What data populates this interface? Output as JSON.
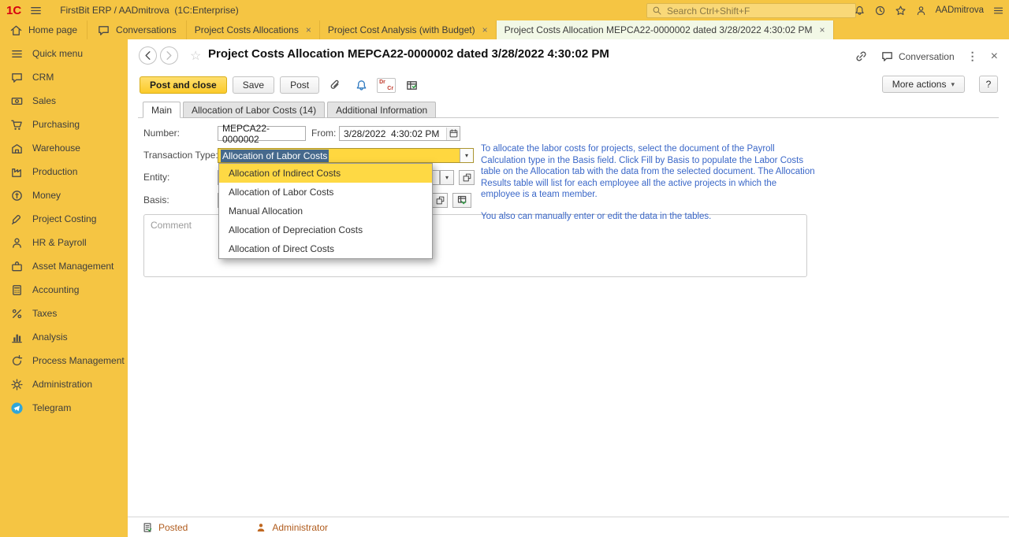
{
  "topbar": {
    "logo": "1С",
    "app_title": "FirstBit ERP / AADmitrova  (1C:Enterprise)",
    "search_placeholder": "Search Ctrl+Shift+F",
    "user": "AADmitrova"
  },
  "nav": {
    "home": "Home page",
    "conversations": "Conversations",
    "tabs": [
      {
        "label": "Project Costs Allocations"
      },
      {
        "label": "Project Cost Analysis (with Budget)"
      },
      {
        "label": "Project Costs Allocation MEPCA22-0000002 dated 3/28/2022 4:30:02 PM"
      }
    ]
  },
  "sidebar": {
    "items": [
      {
        "label": "Quick menu",
        "icon": "menu-icon"
      },
      {
        "label": "CRM",
        "icon": "chat-icon"
      },
      {
        "label": "Sales",
        "icon": "banknote-icon"
      },
      {
        "label": "Purchasing",
        "icon": "cart-icon"
      },
      {
        "label": "Warehouse",
        "icon": "box-icon"
      },
      {
        "label": "Production",
        "icon": "factory-icon"
      },
      {
        "label": "Money",
        "icon": "coin-icon"
      },
      {
        "label": "Project Costing",
        "icon": "rocket-icon"
      },
      {
        "label": "HR & Payroll",
        "icon": "person-icon"
      },
      {
        "label": "Asset Management",
        "icon": "briefcase-icon"
      },
      {
        "label": "Accounting",
        "icon": "calculator-icon"
      },
      {
        "label": "Taxes",
        "icon": "percent-icon"
      },
      {
        "label": "Analysis",
        "icon": "bar-chart-icon"
      },
      {
        "label": "Process Management",
        "icon": "cycle-icon"
      },
      {
        "label": "Administration",
        "icon": "gear-icon"
      },
      {
        "label": "Telegram",
        "icon": "telegram-icon"
      }
    ]
  },
  "doc": {
    "title": "Project Costs Allocation MEPCA22-0000002 dated 3/28/2022 4:30:02 PM",
    "conversation": "Conversation",
    "toolbar": {
      "post_and_close": "Post and close",
      "save": "Save",
      "post": "Post",
      "more_actions": "More actions",
      "help": "?"
    },
    "tabs": [
      {
        "label": "Main"
      },
      {
        "label": "Allocation of Labor Costs (14)"
      },
      {
        "label": "Additional Information"
      }
    ],
    "form": {
      "number_label": "Number:",
      "number_value": "MEPCA22-0000002",
      "from_label": "From:",
      "from_value": "3/28/2022  4:30:02 PM",
      "type_label": "Transaction Type:",
      "type_value": "Allocation of Labor Costs",
      "entity_label": "Entity:",
      "basis_label": "Basis:",
      "comment_placeholder": "Comment"
    },
    "dropdown": {
      "options": [
        {
          "label": "Allocation of Indirect Costs"
        },
        {
          "label": "Allocation of Labor Costs"
        },
        {
          "label": "Manual Allocation"
        },
        {
          "label": "Allocation of Depreciation Costs"
        },
        {
          "label": "Allocation of Direct Costs"
        }
      ]
    },
    "hint": {
      "p1": "To allocate the labor costs for projects, select the document of the Payroll Calculation type in the Basis field. Click Fill by Basis to populate the Labor Costs table on the Allocation tab with the data from the selected document. The Allocation Results table will list for each employee all the active projects in which the employee is a team member.",
      "p2": "You also can manually enter or edit the data in the tables."
    },
    "status": {
      "posted": "Posted",
      "author": "Administrator"
    }
  },
  "colors": {
    "accent_yellow": "#f5c543",
    "highlight_yellow": "#fed944",
    "hint_blue": "#3a67c8",
    "status_orange": "#b05c1e",
    "selection_blue": "#46698c"
  }
}
